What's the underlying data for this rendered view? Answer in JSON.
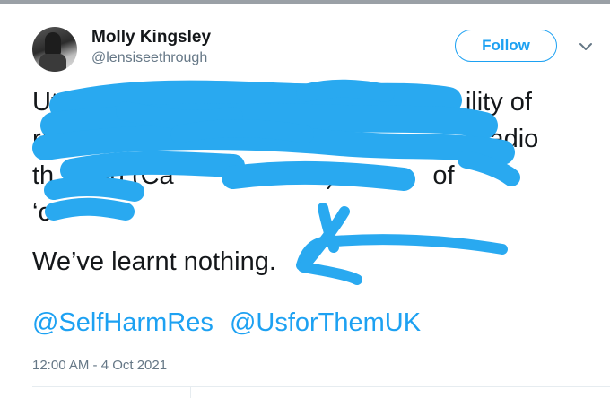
{
  "tweet": {
    "author_name": "Molly Kingsley",
    "author_handle": "@lensiseethrough",
    "follow_label": "Follow",
    "more_icon": "chevron-down-icon",
    "text_lines": [
      "Utter",
      "re",
      "th",
      "‘c"
    ],
    "text_fragments": {
      "line1_tail": "ility of",
      "line2_tail": "radio",
      "line3_mid": "ing (Ca",
      "line3_tail": ") becau",
      "line3_end": "of"
    },
    "closing_line": "We’ve learnt nothing.",
    "mentions": [
      "@SelfHarmRes",
      "@UsforThemUK"
    ],
    "timestamp": "12:00 AM - 4 Oct 2021"
  },
  "colors": {
    "accent": "#1da1f2",
    "scribble": "#29a9f0",
    "secondary_text": "#657786"
  }
}
